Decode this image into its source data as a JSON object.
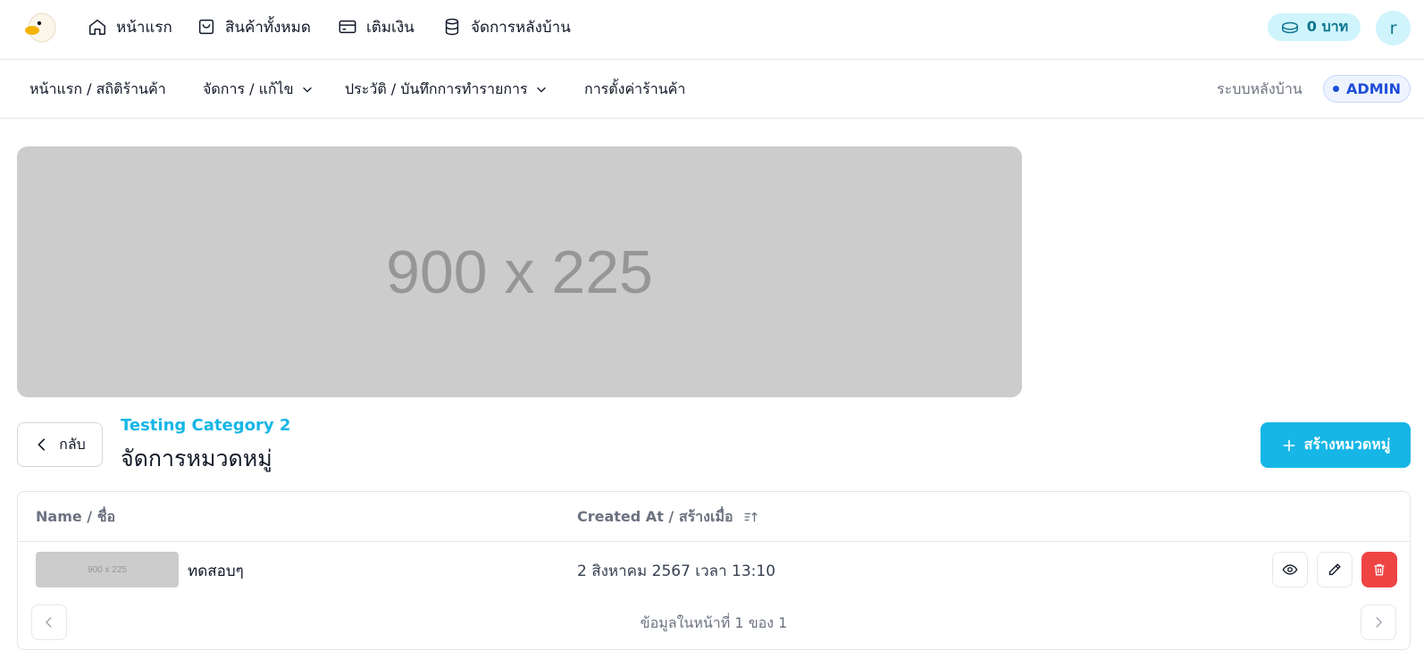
{
  "topnav": {
    "items": [
      {
        "label": "หน้าแรก",
        "icon": "home-icon"
      },
      {
        "label": "สินค้าทั้งหมด",
        "icon": "bag-icon"
      },
      {
        "label": "เติมเงิน",
        "icon": "wallet-card-icon"
      },
      {
        "label": "จัดการหลังบ้าน",
        "icon": "database-icon"
      }
    ],
    "balance": "0 บาท",
    "avatar_letter": "r"
  },
  "subnav": {
    "items": [
      {
        "label": "หน้าแรก / สถิติร้านค้า"
      },
      {
        "label": "จัดการ / แก้ไข"
      },
      {
        "label": "ประวัติ / บันทึกการทำรายการ"
      },
      {
        "label": "การตั้งค่าร้านค้า"
      }
    ],
    "backend_label": "ระบบหลังบ้าน",
    "role_badge": "ADMIN"
  },
  "banner": {
    "placeholder": "900 x 225"
  },
  "header": {
    "back_label": "กลับ",
    "category": "Testing Category 2",
    "title": "จัดการหมวดหมู่",
    "create_label": "สร้างหมวดหมู่"
  },
  "table": {
    "columns": [
      "Name / ชื่อ",
      "Created At / สร้างเมื่อ"
    ],
    "rows": [
      {
        "thumb": "900 x 225",
        "name": "ทดสอบๆ",
        "created_at": "2 สิงหาคม 2567 เวลา 13:10"
      }
    ],
    "pagination": "ข้อมูลในหน้าที่ 1 ของ 1"
  },
  "colors": {
    "accent": "#16b6e6",
    "danger": "#ef4444",
    "admin": "#1d4ed8"
  }
}
